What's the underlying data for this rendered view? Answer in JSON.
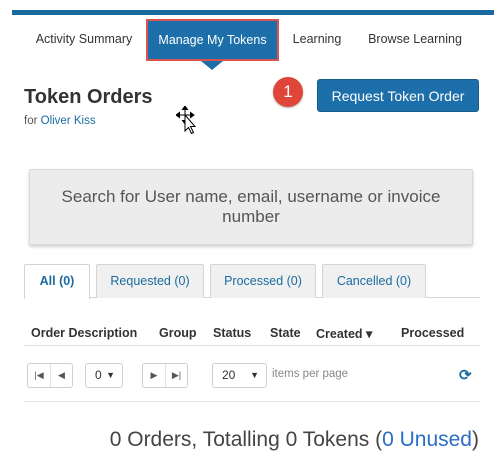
{
  "nav": {
    "tabs": [
      {
        "label": "Activity Summary"
      },
      {
        "label": "Manage My Tokens"
      },
      {
        "label": "Learning"
      },
      {
        "label": "Browse Learning"
      }
    ]
  },
  "header": {
    "title": "Token Orders",
    "for_prefix": "for",
    "user_name": "Oliver Kiss"
  },
  "callout": {
    "number": "1"
  },
  "request_button": {
    "label": "Request Token Order"
  },
  "search": {
    "placeholder": "Search for User name, email, username or invoice number"
  },
  "filter_tabs": [
    {
      "label": "All (0)",
      "active": true
    },
    {
      "label": "Requested (0)",
      "active": false
    },
    {
      "label": "Processed (0)",
      "active": false
    },
    {
      "label": "Cancelled (0)",
      "active": false
    }
  ],
  "table": {
    "columns": [
      "Order Description",
      "Group",
      "Status",
      "State",
      "Created ▾",
      "Processed"
    ]
  },
  "pager": {
    "page_value": "0",
    "page_size": "20",
    "items_per_page_label": "items per page"
  },
  "summary": {
    "prefix": "0 Orders, Totalling 0 Tokens (",
    "unused": "0 Unused",
    "suffix": ")"
  },
  "colors": {
    "primary": "#1c6fa8",
    "highlight_border": "#d9534f",
    "badge": "#e0453a",
    "unused_link": "#2a6ec6"
  }
}
